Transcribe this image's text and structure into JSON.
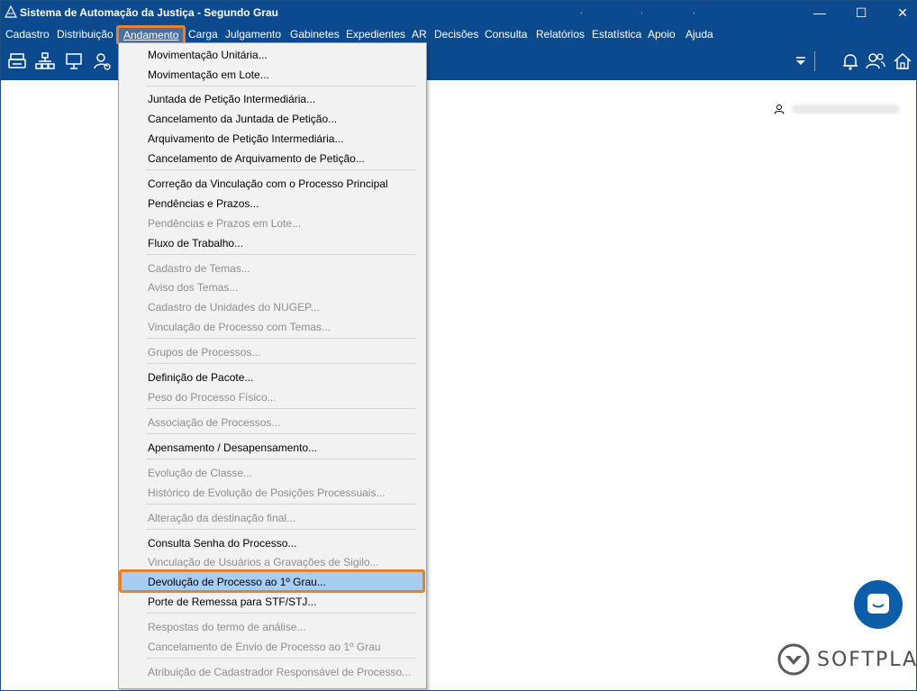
{
  "window": {
    "title": "Sistema de Automação da Justiça - Segundo Grau",
    "title_dots": [
      ".",
      ".",
      "."
    ],
    "controls": {
      "minimize": "—",
      "maximize": "☐",
      "close": "✕"
    }
  },
  "menubar": {
    "items": [
      "Cadastro",
      "Distribuição",
      "Andamento",
      "Carga",
      "Julgamento",
      "Gabinetes",
      "Expedientes",
      "AR",
      "Decisões",
      "Consulta",
      "Relatórios",
      "Estatística",
      "Apoio",
      "Ajuda"
    ],
    "active": "Andamento"
  },
  "toolbar": {
    "left_icons": [
      "printer-icon",
      "org-chart-icon",
      "presentation-icon",
      "user-settings-icon"
    ],
    "right_icons": [
      "filter-dropdown-icon",
      "bell-icon",
      "users-icon",
      "home-icon"
    ]
  },
  "dropdown": {
    "items": [
      {
        "label": "Movimentação Unitária...",
        "enabled": true
      },
      {
        "label": "Movimentação em Lote...",
        "enabled": true
      },
      {
        "label": "Juntada de Petição Intermediária...",
        "enabled": true
      },
      {
        "label": "Cancelamento da Juntada de Petição...",
        "enabled": true
      },
      {
        "label": "Arquivamento de Petição Intermediária...",
        "enabled": true
      },
      {
        "label": "Cancelamento de Arquivamento de Petição...",
        "enabled": true
      },
      {
        "label": "Correção da Vinculação com o Processo Principal",
        "enabled": true
      },
      {
        "label": "Pendências e Prazos...",
        "enabled": true
      },
      {
        "label": "Pendências e Prazos em Lote...",
        "enabled": false
      },
      {
        "label": "Fluxo de Trabalho...",
        "enabled": true
      },
      {
        "label": "Cadastro de Temas...",
        "enabled": false
      },
      {
        "label": "Aviso dos Temas...",
        "enabled": false
      },
      {
        "label": "Cadastro de Unidades do NUGEP...",
        "enabled": false
      },
      {
        "label": "Vinculação de Processo com Temas...",
        "enabled": false
      },
      {
        "label": "Grupos de Processos...",
        "enabled": false
      },
      {
        "label": "Definição de Pacote...",
        "enabled": true
      },
      {
        "label": "Peso do Processo Físico...",
        "enabled": false
      },
      {
        "label": "Associação de Processos...",
        "enabled": false
      },
      {
        "label": "Apensamento / Desapensamento...",
        "enabled": true
      },
      {
        "label": "Evolução de Classe...",
        "enabled": false
      },
      {
        "label": "Histórico de Evolução de Posições Processuais...",
        "enabled": false
      },
      {
        "label": "Alteração da destinação final...",
        "enabled": false
      },
      {
        "label": "Consulta Senha do Processo...",
        "enabled": true
      },
      {
        "label": "Vinculação de Usuários a Gravações de Sigilo...",
        "enabled": false
      },
      {
        "label": "Devolução de Processo ao 1º Grau...",
        "enabled": true,
        "highlighted": true
      },
      {
        "label": "Porte de Remessa para STF/STJ...",
        "enabled": true
      },
      {
        "label": "Respostas do termo de análise...",
        "enabled": false
      },
      {
        "label": "Cancelamento de Envio de Processo ao 1º Grau",
        "enabled": false
      },
      {
        "label": "Atribuição de Cadastrador Responsável de Processo...",
        "enabled": false
      }
    ]
  },
  "brand": {
    "name": "SOFTPLAN"
  },
  "colors": {
    "titlebar": "#0b4a8f",
    "highlight_border": "#e8822a",
    "highlight_fill": "#a8cdf0",
    "disabled_text": "#8e8e8e"
  }
}
